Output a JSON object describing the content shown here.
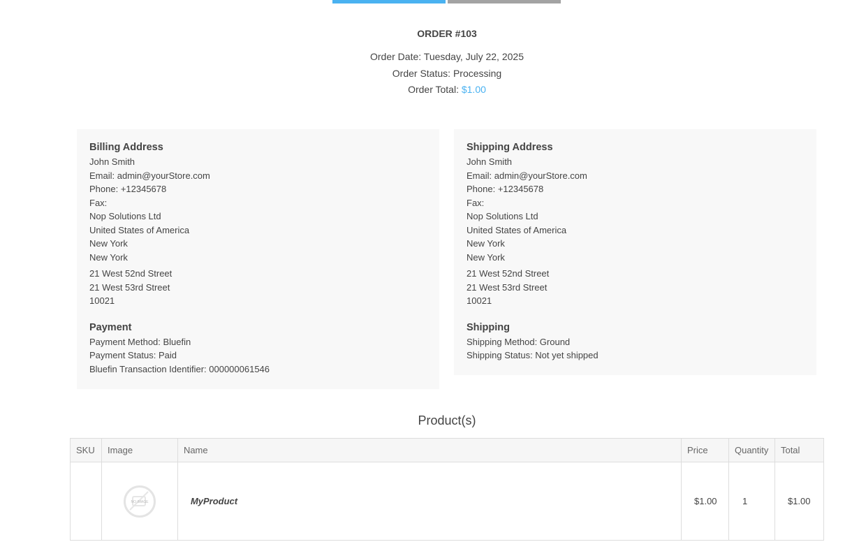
{
  "order": {
    "title": "ORDER #103",
    "date_label": "Order Date: ",
    "date_value": "Tuesday, July 22, 2025",
    "status_label": "Order Status: ",
    "status_value": "Processing",
    "total_label": "Order Total: ",
    "total_value": "$1.00"
  },
  "billing": {
    "heading": "Billing Address",
    "name": "John Smith",
    "email": "Email: admin@yourStore.com",
    "phone": "Phone: +12345678",
    "fax": "Fax:",
    "company": "Nop Solutions Ltd",
    "country": "United States of America",
    "state": "New York",
    "city": "New York",
    "address1": "21 West 52nd Street",
    "address2": "21 West 53rd Street",
    "zip": "10021"
  },
  "shipping_address": {
    "heading": "Shipping Address",
    "name": "John Smith",
    "email": "Email: admin@yourStore.com",
    "phone": "Phone: +12345678",
    "fax": "Fax:",
    "company": "Nop Solutions Ltd",
    "country": "United States of America",
    "state": "New York",
    "city": "New York",
    "address1": "21 West 52nd Street",
    "address2": "21 West 53rd Street",
    "zip": "10021"
  },
  "payment": {
    "heading": "Payment",
    "method": "Payment Method: Bluefin",
    "status": "Payment Status: Paid",
    "transaction": "Bluefin Transaction Identifier: 000000061546"
  },
  "shipping": {
    "heading": "Shipping",
    "method": "Shipping Method: Ground",
    "status": "Shipping Status: Not yet shipped"
  },
  "products": {
    "title": "Product(s)",
    "columns": [
      "SKU",
      "Image",
      "Name",
      "Price",
      "Quantity",
      "Total"
    ],
    "rows": [
      {
        "sku": "",
        "image_icon": "no-image-icon",
        "name": "MyProduct",
        "price": "$1.00",
        "quantity": "1",
        "total": "$1.00"
      }
    ]
  },
  "colors": {
    "accent": "#4ab2f1",
    "secondary": "#a3a3a3",
    "panel_bg": "#f8f8f8",
    "text": "#444444"
  }
}
